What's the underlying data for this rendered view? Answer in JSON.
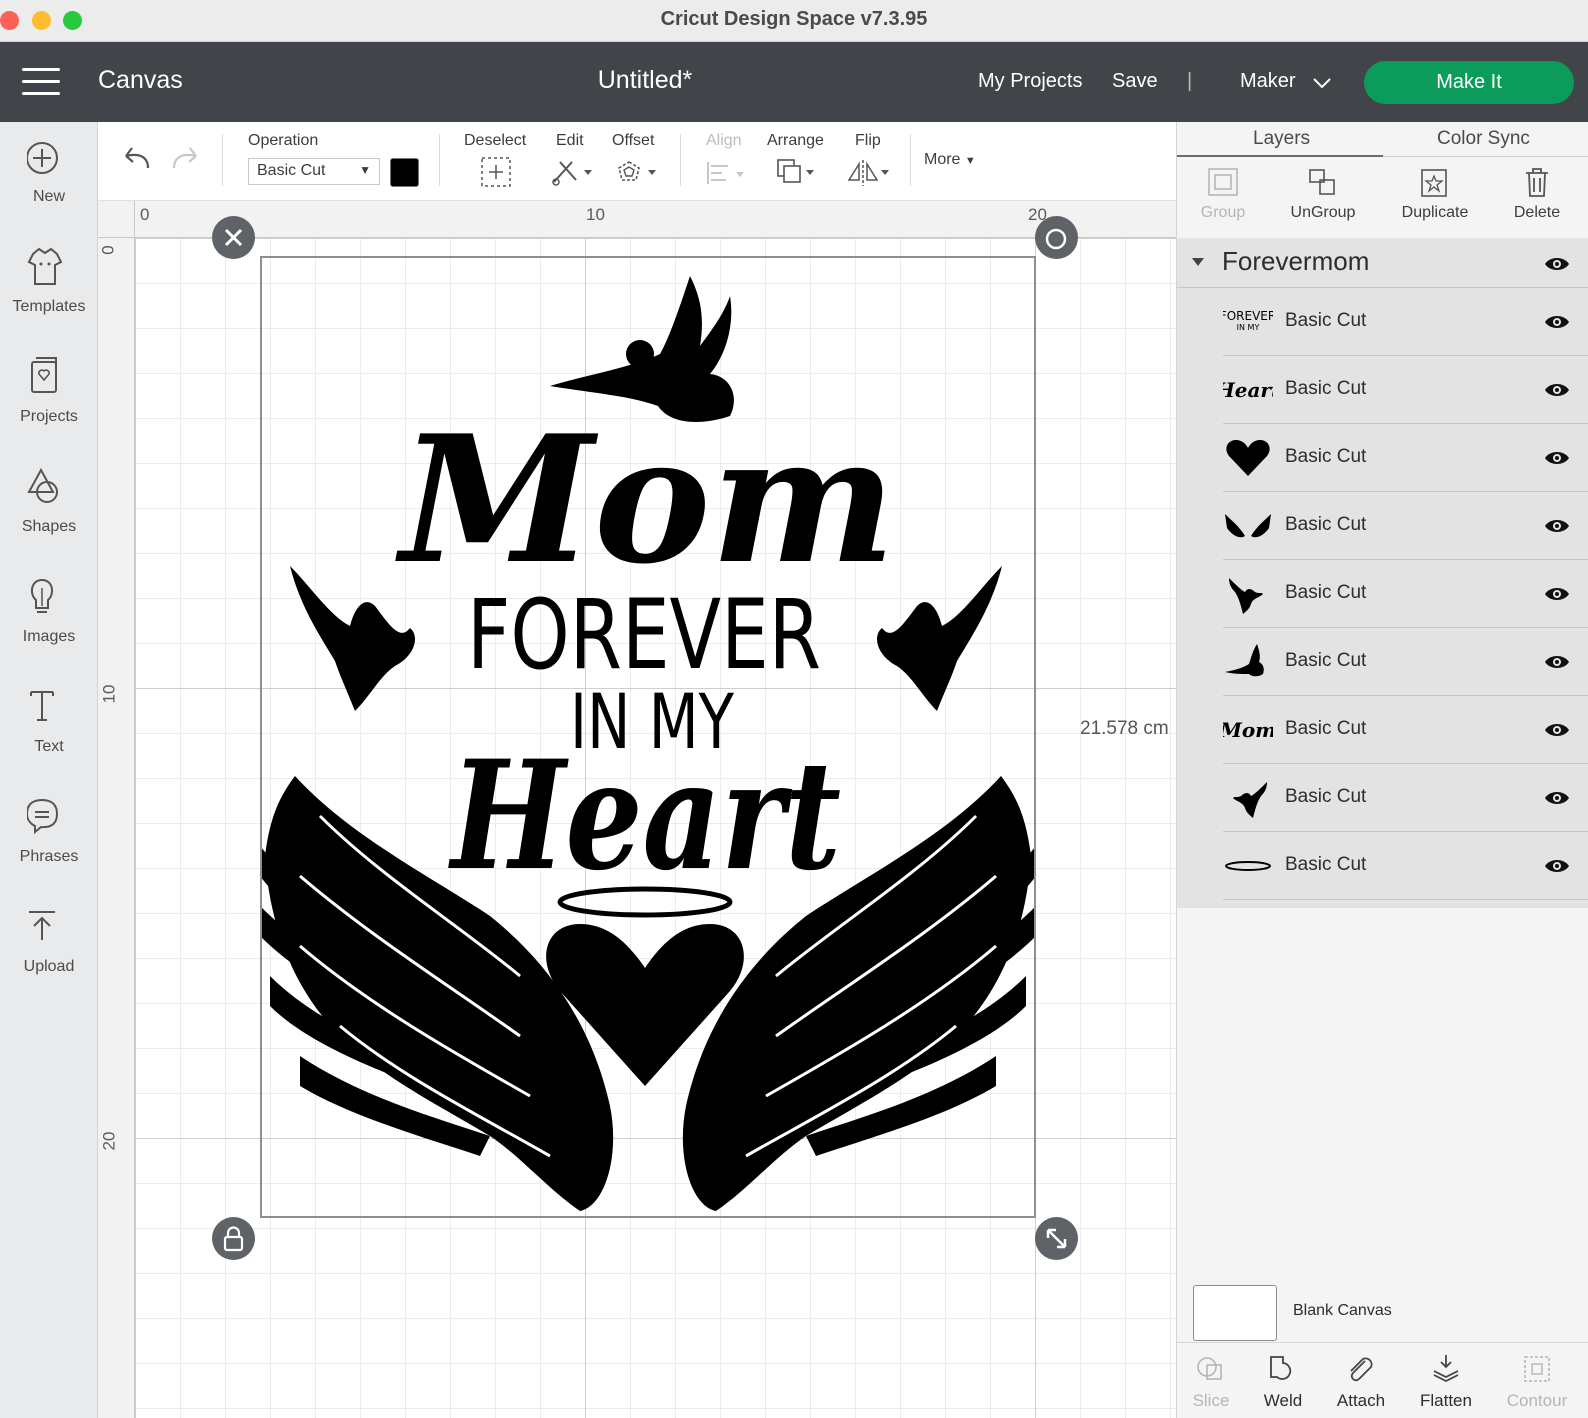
{
  "window": {
    "title": "Cricut Design Space  v7.3.95"
  },
  "header": {
    "section": "Canvas",
    "project_title": "Untitled*",
    "my_projects": "My Projects",
    "save": "Save",
    "divider": "|",
    "machine": "Maker",
    "make_it": "Make It"
  },
  "sidebar": {
    "items": [
      {
        "label": "New",
        "icon": "plus-circle-icon"
      },
      {
        "label": "Templates",
        "icon": "shirt-icon"
      },
      {
        "label": "Projects",
        "icon": "projects-icon"
      },
      {
        "label": "Shapes",
        "icon": "shapes-icon"
      },
      {
        "label": "Images",
        "icon": "lightbulb-icon"
      },
      {
        "label": "Text",
        "icon": "text-icon"
      },
      {
        "label": "Phrases",
        "icon": "speech-bubble-icon"
      },
      {
        "label": "Upload",
        "icon": "upload-icon"
      }
    ]
  },
  "toolbar": {
    "operation_label": "Operation",
    "operation_value": "Basic Cut",
    "deselect": "Deselect",
    "edit": "Edit",
    "offset": "Offset",
    "align": "Align",
    "arrange": "Arrange",
    "flip": "Flip",
    "more": "More",
    "swatch_color": "#000000"
  },
  "canvas": {
    "ruler_top": [
      "0",
      "10",
      "20"
    ],
    "ruler_left": [
      "0",
      "10",
      "20"
    ],
    "dimension_label": "21.578 cm",
    "artwork": {
      "line1": "Mom",
      "line2": "FOREVER",
      "line3": "IN MY",
      "line4": "Heart"
    }
  },
  "layers_panel": {
    "tabs": [
      "Layers",
      "Color Sync"
    ],
    "actions": [
      {
        "label": "Group",
        "enabled": false
      },
      {
        "label": "UnGroup",
        "enabled": true
      },
      {
        "label": "Duplicate",
        "enabled": true
      },
      {
        "label": "Delete",
        "enabled": true
      }
    ],
    "group_name": "Forevermom",
    "layers": [
      {
        "name": "Basic Cut",
        "thumb": "forever-in-my-text"
      },
      {
        "name": "Basic Cut",
        "thumb": "heart-text"
      },
      {
        "name": "Basic Cut",
        "thumb": "heart-shape"
      },
      {
        "name": "Basic Cut",
        "thumb": "wings"
      },
      {
        "name": "Basic Cut",
        "thumb": "dove-right"
      },
      {
        "name": "Basic Cut",
        "thumb": "dove-top"
      },
      {
        "name": "Basic Cut",
        "thumb": "mom-text"
      },
      {
        "name": "Basic Cut",
        "thumb": "dove-left"
      },
      {
        "name": "Basic Cut",
        "thumb": "halo"
      }
    ],
    "thumb_text": {
      "forever": "FOREVER",
      "in_my": "IN MY",
      "heart": "Heart",
      "mom": "Mom"
    },
    "blank_canvas": "Blank Canvas",
    "bottom_actions": [
      {
        "label": "Slice",
        "enabled": false
      },
      {
        "label": "Weld",
        "enabled": true
      },
      {
        "label": "Attach",
        "enabled": true
      },
      {
        "label": "Flatten",
        "enabled": true
      },
      {
        "label": "Contour",
        "enabled": false
      }
    ]
  },
  "colors": {
    "header_bg": "#414449",
    "make_it": "#0b9b5a",
    "sidebar_bg": "#e9eaeb"
  }
}
